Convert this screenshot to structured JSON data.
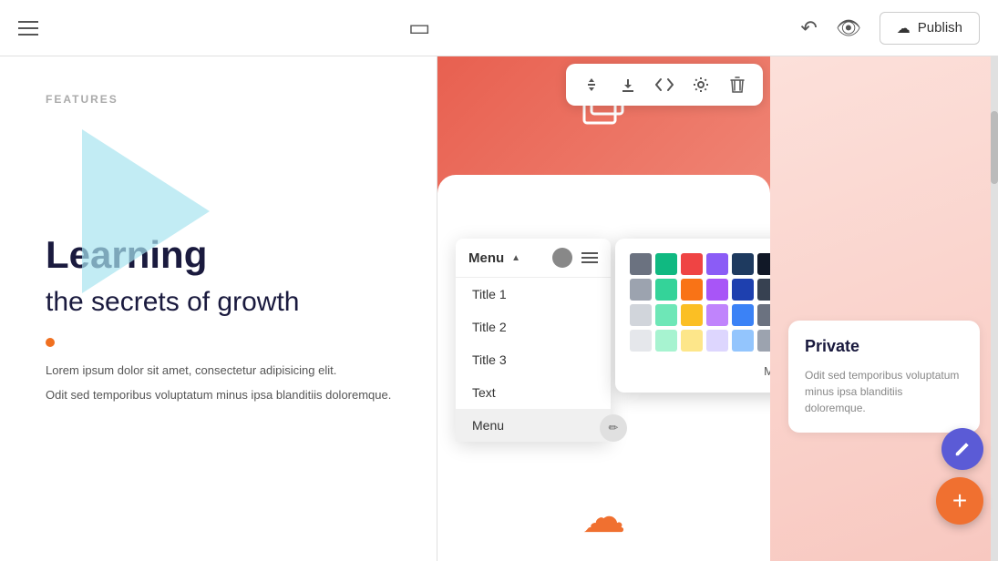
{
  "topbar": {
    "publish_label": "Publish"
  },
  "left": {
    "features_label": "FEATURES",
    "heading": "Learning",
    "subheading": "the secrets of growth",
    "body1": "Lorem ipsum dolor sit amet, consectetur adipisicing elit.",
    "body2": "Odit sed temporibus voluptatum minus ipsa blanditiis doloremque."
  },
  "toolbar": {
    "buttons": [
      "↑↓",
      "↓",
      "</>",
      "⚙",
      "🗑"
    ]
  },
  "dropdown": {
    "menu_label": "Menu",
    "items": [
      "Title 1",
      "Title 2",
      "Title 3",
      "Text",
      "Menu"
    ]
  },
  "colorpicker": {
    "more_label": "More >",
    "colors": [
      "#6b7280",
      "#10b981",
      "#ef4444",
      "#8b5cf6",
      "#1e3a5f",
      "#111827",
      "#9ca3af",
      "#34d399",
      "#f97316",
      "#a855f7",
      "#1e40af",
      "",
      "#d1d5db",
      "#6ee7b7",
      "#fbbf24",
      "#c084fc",
      "#3b82f6",
      "",
      "#e5e7eb",
      "#a7f3d0",
      "#fde68a",
      "#ddd6fe",
      "#93c5fd",
      "",
      "#f3f4f6",
      "#d1fae5",
      "#fef3c7",
      "#ede9fe",
      "#bfdbfe",
      "#9ca3af"
    ]
  },
  "right": {
    "private_title": "Private",
    "private_text": "Odit sed temporibus voluptatum minus ipsa blanditiis doloremque."
  }
}
